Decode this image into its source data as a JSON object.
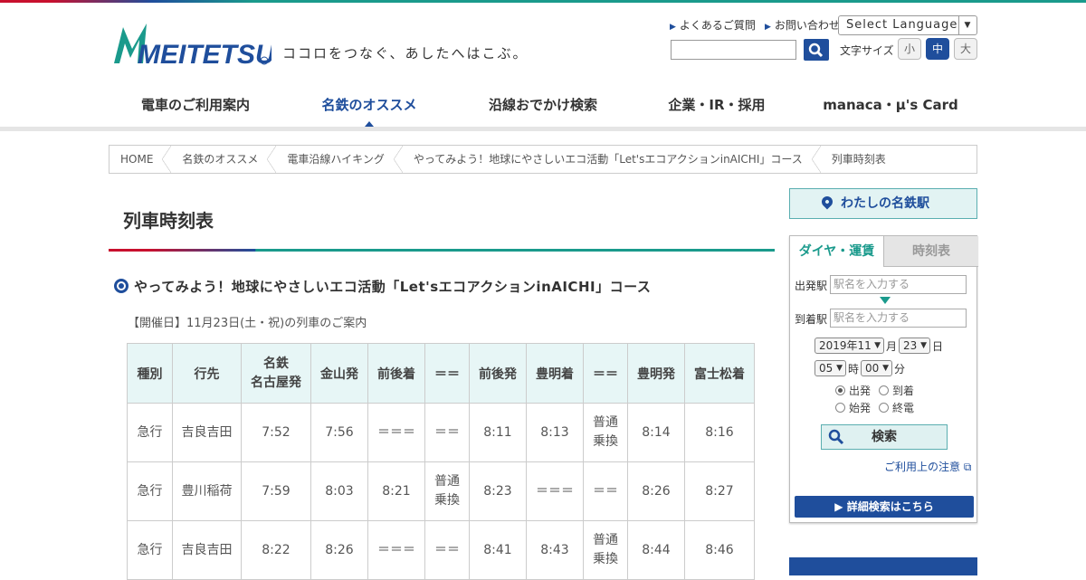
{
  "header": {
    "logo_text": "MEITETSU",
    "tagline": "ココロをつなぐ、あしたへはこぶ。",
    "links": [
      "よくあるご質問",
      "お問い合わせ"
    ],
    "language_select": "Select Language",
    "fontsize_label": "文字サイズ",
    "fontsize_options": [
      "小",
      "中",
      "大"
    ],
    "fontsize_selected": "中"
  },
  "nav": {
    "items": [
      "電車のご利用案内",
      "名鉄のオススメ",
      "沿線おでかけ検索",
      "企業・IR・採用",
      "manaca・μ's Card"
    ],
    "active": "名鉄のオススメ"
  },
  "breadcrumb": [
    "HOME",
    "名鉄のオススメ",
    "電車沿線ハイキング",
    "やってみよう！地球にやさしいエコ活動「Let'sエコアクションinAICHI」コース",
    "列車時刻表"
  ],
  "main": {
    "page_title": "列車時刻表",
    "section_title": "やってみよう！地球にやさしいエコ活動「Let'sエコアクションinAICHI」コース",
    "note": "【開催日】11月23日(土・祝)の列車のご案内",
    "table": {
      "headers": [
        "種別",
        "行先",
        "名鉄\n名古屋発",
        "金山発",
        "前後着",
        "＝＝",
        "前後発",
        "豊明着",
        "＝＝",
        "豊明発",
        "富士松着"
      ],
      "rows": [
        [
          "急行",
          "吉良吉田",
          "7:52",
          "7:56",
          "＝＝＝",
          "＝＝",
          "8:11",
          "8:13",
          "普通\n乗換",
          "8:14",
          "8:16"
        ],
        [
          "急行",
          "豊川稲荷",
          "7:59",
          "8:03",
          "8:21",
          "普通\n乗換",
          "8:23",
          "＝＝＝",
          "＝＝",
          "8:26",
          "8:27"
        ],
        [
          "急行",
          "吉良吉田",
          "8:22",
          "8:26",
          "＝＝＝",
          "＝＝",
          "8:41",
          "8:43",
          "普通\n乗換",
          "8:44",
          "8:46"
        ]
      ]
    }
  },
  "sidebar": {
    "my_station": "わたしの名鉄駅",
    "tabs": [
      "ダイヤ・運賃",
      "時刻表"
    ],
    "active_tab": "ダイヤ・運賃",
    "from_label": "出発駅",
    "to_label": "到着駅",
    "station_placeholder": "駅名を入力する",
    "year_month": "2019年11",
    "month_unit": "月",
    "day": "23",
    "day_unit": "日",
    "hour": "05",
    "hour_unit": "時",
    "minute": "00",
    "minute_unit": "分",
    "radio_options": [
      "出発",
      "到着",
      "始発",
      "終電"
    ],
    "radio_selected": "出発",
    "search_button": "検索",
    "caution_link": "ご利用上の注意",
    "detail_button": "詳細検索はこちら"
  },
  "colors": {
    "brand_blue": "#1f4e9c",
    "teal": "#1a9a8c",
    "red": "#c8102e"
  }
}
